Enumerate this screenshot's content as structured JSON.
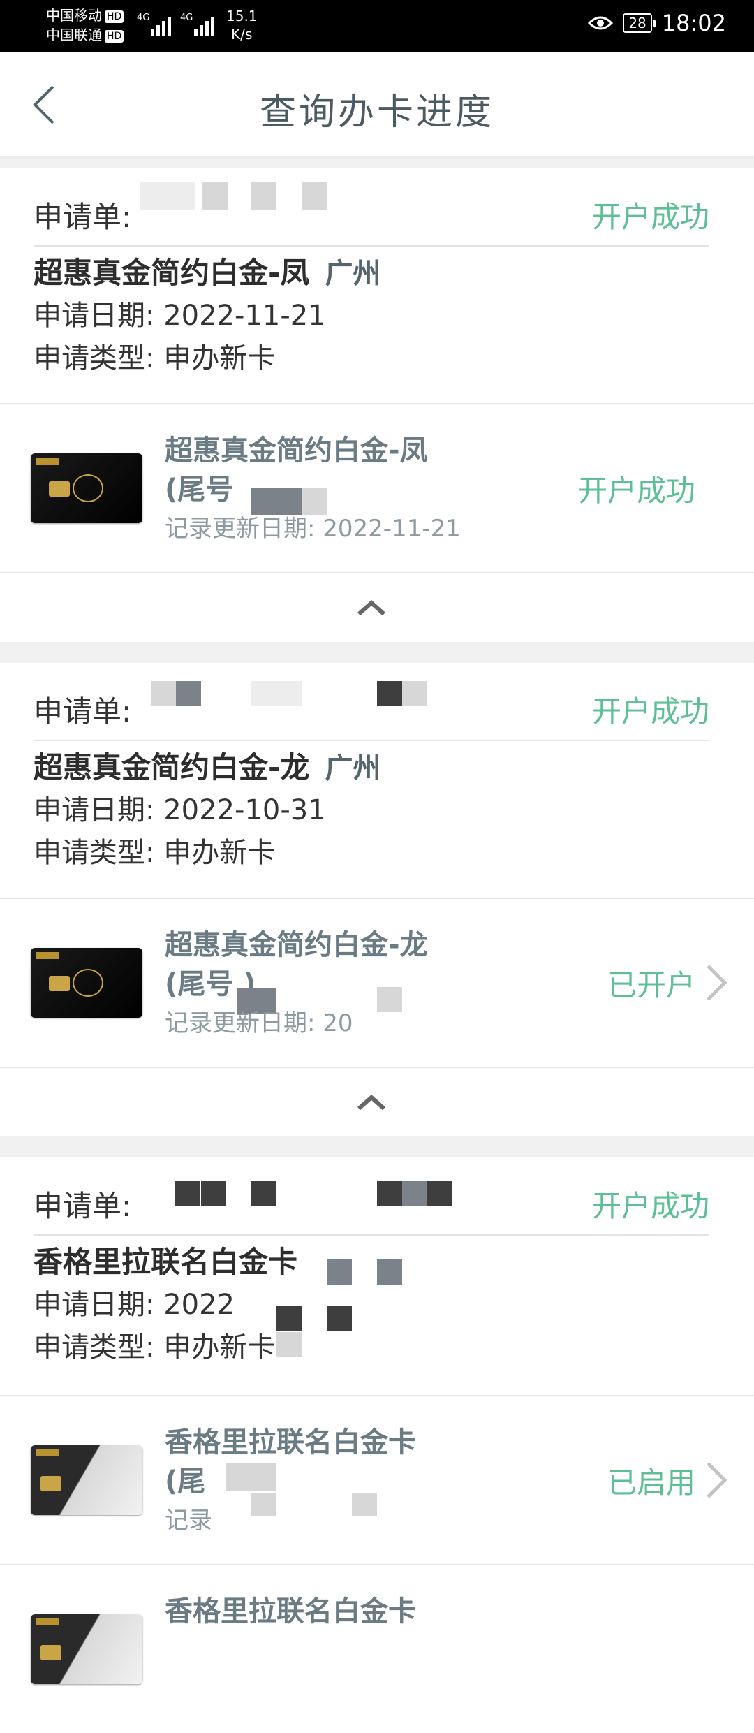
{
  "status_bar": {
    "carrier1": "中国移动",
    "carrier2": "中国联通",
    "hd": "HD",
    "net1": "4G",
    "net2": "4G",
    "speed_value": "15.1",
    "speed_unit": "K/s",
    "battery": "28",
    "time": "18:02"
  },
  "header": {
    "title": "查询办卡进度"
  },
  "applications": [
    {
      "id_label": "申请单:",
      "status": "开户成功",
      "card_name": "超惠真金简约白金-凤",
      "city": "广州",
      "date_line": "申请日期:  2022-11-21",
      "type_line": "申请类型:  申办新卡",
      "card": {
        "title_line1": "超惠真金简约白金-凤",
        "title_line2": "(尾号",
        "update": "记录更新日期:  2022-11-21",
        "status": "开户成功"
      }
    },
    {
      "id_label": "申请单:",
      "status": "开户成功",
      "card_name": "超惠真金简约白金-龙",
      "city": "广州",
      "date_line": "申请日期:  2022-10-31",
      "type_line": "申请类型:  申办新卡",
      "card": {
        "title_line1": "超惠真金简约白金-龙",
        "title_line2": "(尾号     )",
        "update": "记录更新日期:  20",
        "status": "已开户"
      }
    },
    {
      "id_label": "申请单:",
      "status": "开户成功",
      "card_name": "香格里拉联名白金卡",
      "city": "",
      "date_line": "申请日期:  2022",
      "type_line": "申请类型:  申办新卡",
      "card": {
        "title_line1": "香格里拉联名白金卡",
        "title_line2": "(尾",
        "update": "记录",
        "status": "已启用"
      },
      "card2": {
        "title_line1": "香格里拉联名白金卡"
      }
    }
  ],
  "colors": {
    "success_green": "#5cbf95",
    "title_gray": "#4c5a61"
  },
  "icons": [
    "back-icon",
    "eye-icon",
    "caret-up-icon",
    "chevron-right-icon"
  ]
}
